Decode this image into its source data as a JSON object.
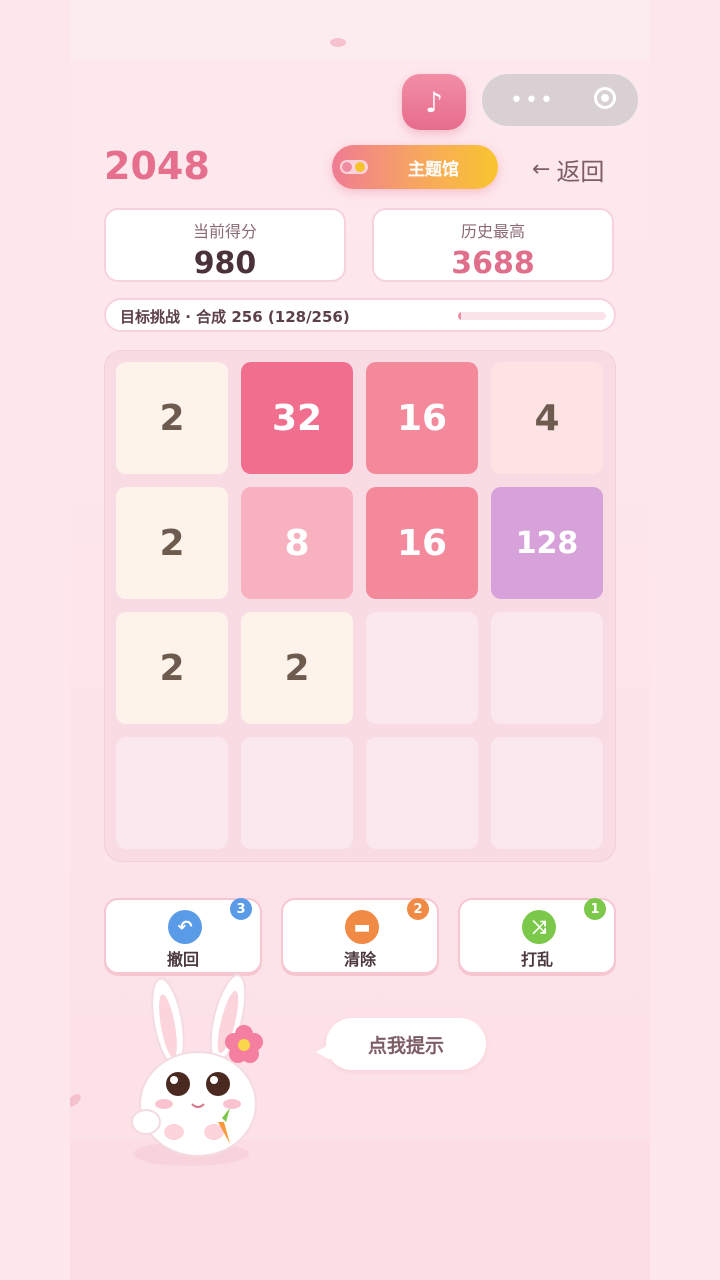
{
  "header": {
    "music_icon": "music-note-icon",
    "music_glyph": "♪",
    "capsule_dots": "•••",
    "title": "2048",
    "theme_label": "主题馆",
    "back_label": "返回",
    "back_arrow": "←"
  },
  "scores": {
    "current_label": "当前得分",
    "current_value": "980",
    "best_label": "历史最高",
    "best_value": "3688"
  },
  "goal": {
    "text": "目标挑战 · 合成 256 (128/256)",
    "progress": 0.02
  },
  "board": {
    "size": 4,
    "tiles": [
      [
        2,
        32,
        16,
        4
      ],
      [
        2,
        8,
        16,
        128
      ],
      [
        2,
        2,
        null,
        null
      ],
      [
        null,
        null,
        null,
        null
      ]
    ],
    "colors": {
      "2": {
        "bg": "#fdf3ea",
        "fg": "#6e5b4f"
      },
      "4": {
        "bg": "#fde3e3",
        "fg": "#6e5b4f"
      },
      "8": {
        "bg": "#f8b1bf",
        "fg": "#ffffff"
      },
      "16": {
        "bg": "#f4899c",
        "fg": "#ffffff"
      },
      "32": {
        "bg": "#f26e8f",
        "fg": "#ffffff"
      },
      "128": {
        "bg": "#d7a2da",
        "fg": "#ffffff"
      }
    }
  },
  "tools": [
    {
      "label": "撤回",
      "count": "3",
      "icon": "undo-icon",
      "glyph": "↶",
      "color": "#5a9be8",
      "badge_color": "#5a9be8"
    },
    {
      "label": "清除",
      "count": "2",
      "icon": "eraser-icon",
      "glyph": "▬",
      "color": "#f08a45",
      "badge_color": "#f08a45"
    },
    {
      "label": "打乱",
      "count": "1",
      "icon": "shuffle-icon",
      "glyph": "⤨",
      "color": "#7cc84a",
      "badge_color": "#7cc84a"
    }
  ],
  "hint": {
    "label": "点我提示"
  }
}
